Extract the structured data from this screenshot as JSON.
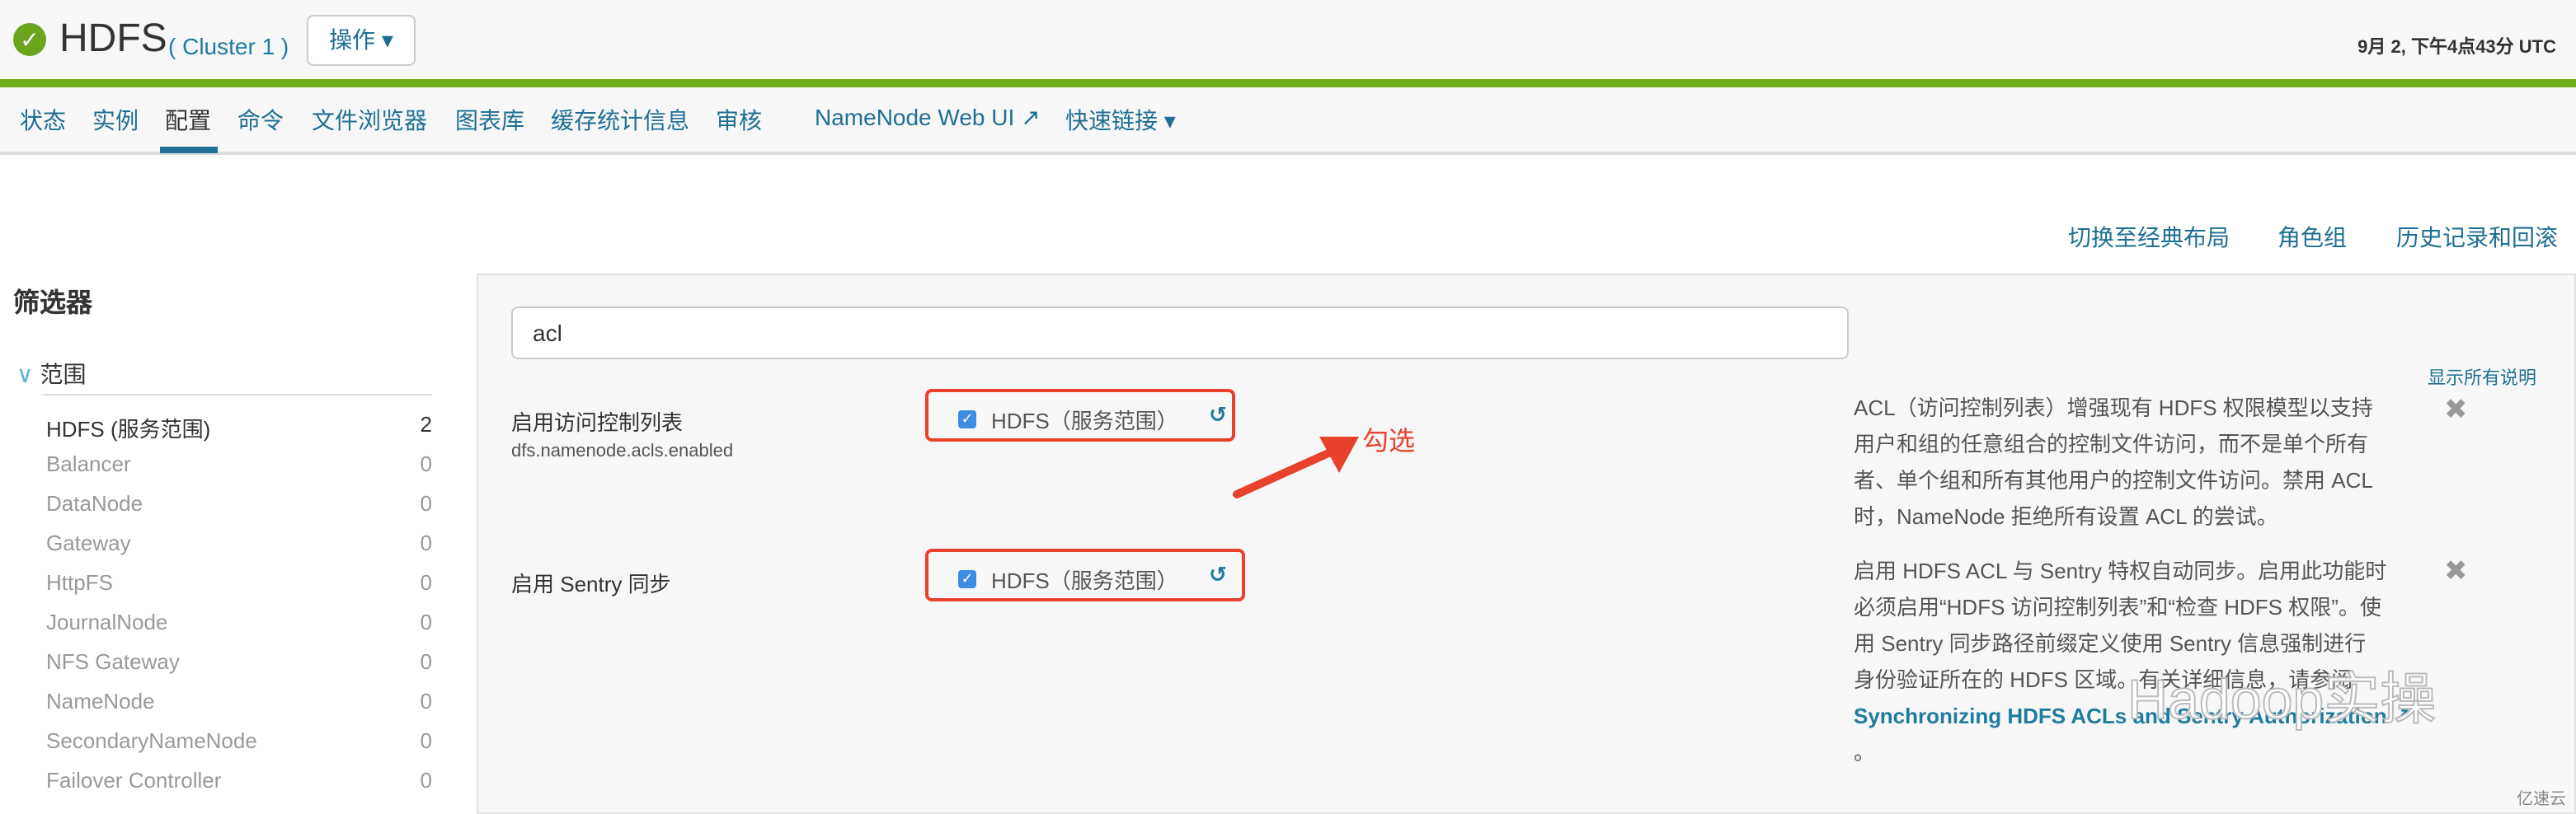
{
  "header": {
    "title": "HDFS",
    "cluster": "( Cluster 1 )",
    "actions_label": "操作 ▾",
    "status_icon": "check-circle-icon",
    "time": "9月 2, 下午4点43分 UTC"
  },
  "nav": {
    "items": [
      "状态",
      "实例",
      "配置",
      "命令",
      "文件浏览器",
      "图表库",
      "缓存统计信息",
      "审核",
      "NameNode Web UI ↗",
      "快速链接 ▾"
    ],
    "active": "配置"
  },
  "toplinks": [
    "切换至经典布局",
    "角色组",
    "历史记录和回滚"
  ],
  "sidebar": {
    "title": "筛选器",
    "scope_label": "范围",
    "items": [
      {
        "label": "HDFS (服务范围)",
        "count": "2"
      },
      {
        "label": "Balancer",
        "count": "0"
      },
      {
        "label": "DataNode",
        "count": "0"
      },
      {
        "label": "Gateway",
        "count": "0"
      },
      {
        "label": "HttpFS",
        "count": "0"
      },
      {
        "label": "JournalNode",
        "count": "0"
      },
      {
        "label": "NFS Gateway",
        "count": "0"
      },
      {
        "label": "NameNode",
        "count": "0"
      },
      {
        "label": "SecondaryNameNode",
        "count": "0"
      },
      {
        "label": "Failover Controller",
        "count": "0"
      }
    ]
  },
  "main": {
    "search_value": "acl",
    "show_all": "显示所有说明",
    "props": [
      {
        "label": "启用访问控制列表",
        "key": "dfs.namenode.acls.enabled",
        "value": "HDFS（服务范围）",
        "checked": true,
        "desc": [
          "ACL（访问控制列表）增强现有 HDFS 权限模型以支持",
          "用户和组的任意组合的控制文件访问，而不是单个所有",
          "者、单个组和所有其他用户的控制文件访问。禁用 ACL",
          "时，NameNode 拒绝所有设置 ACL 的尝试。"
        ]
      },
      {
        "label": "启用 Sentry 同步",
        "value": "HDFS（服务范围）",
        "checked": true,
        "desc": [
          "启用 HDFS ACL 与 Sentry 特权自动同步。启用此功能时",
          "必须启用“HDFS 访问控制列表”和“检查 HDFS 权限”。使",
          "用 Sentry 同步路径前缀定义使用 Sentry 信息强制进行",
          "身份验证所在的 HDFS 区域。有关详细信息，请参阅"
        ],
        "link": "Synchronizing HDFS ACLs and Sentry Authorization ↗",
        "tail": "。"
      }
    ]
  },
  "annotation": {
    "text": "勾选",
    "color": "#e8422d"
  },
  "watermark": {
    "text": "Hadoop实操",
    "site": "亿速云"
  },
  "colors": {
    "accent": "#1f6f94",
    "brand_green": "#72ad1c",
    "highlight": "#e8422d"
  }
}
